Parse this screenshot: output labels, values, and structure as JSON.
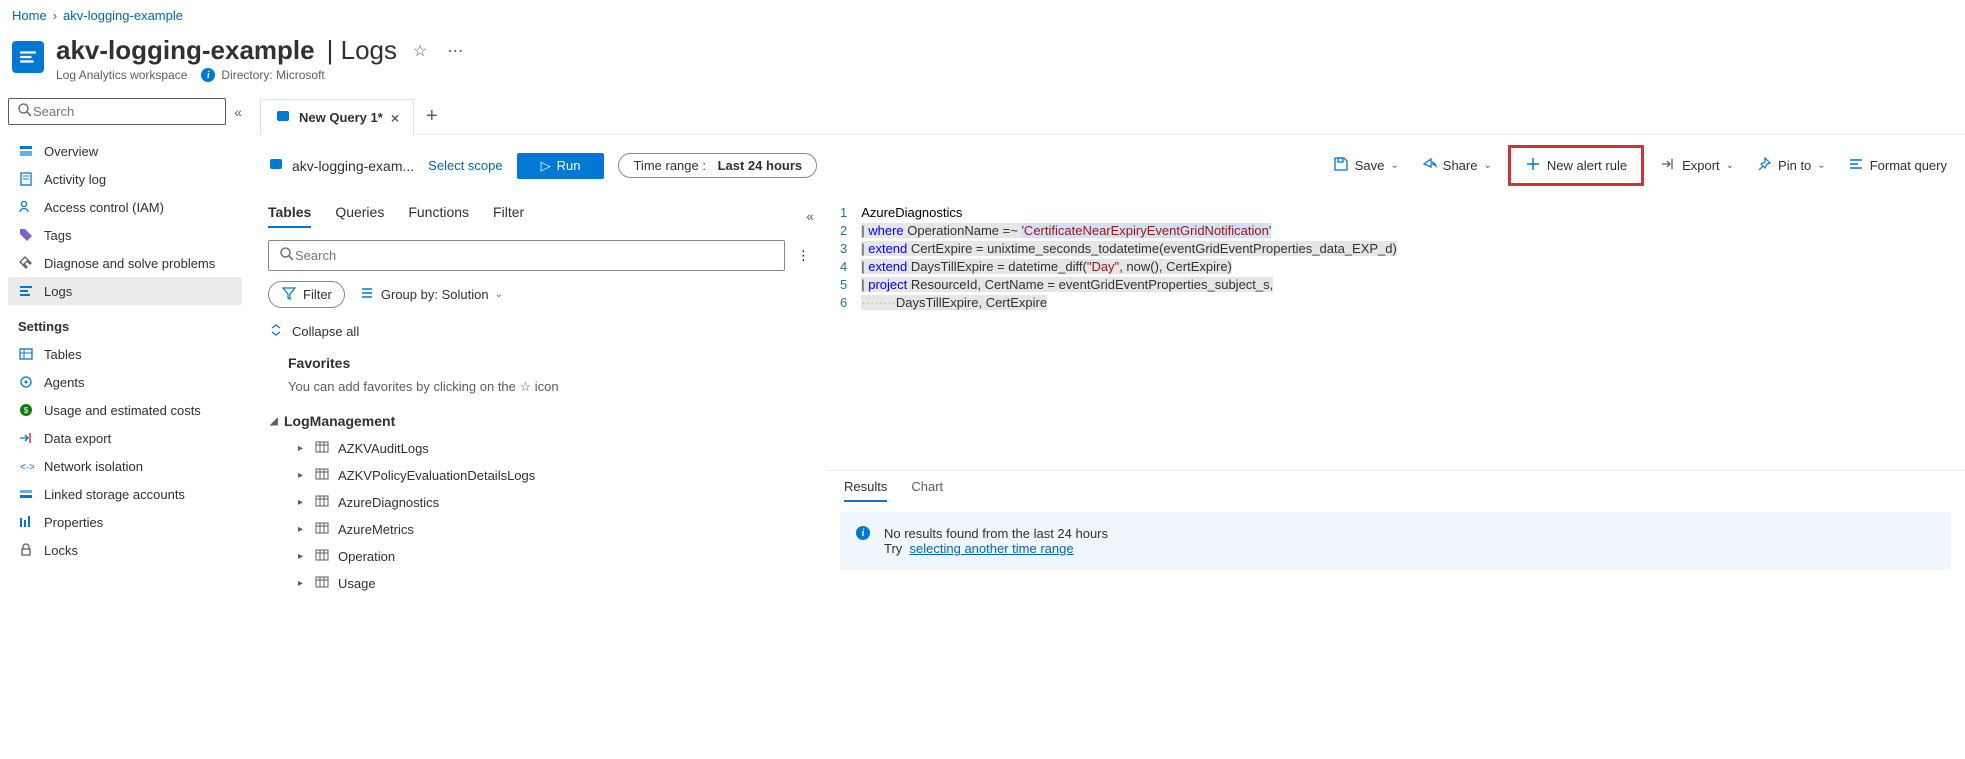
{
  "breadcrumb": {
    "home": "Home",
    "resource": "akv-logging-example"
  },
  "header": {
    "title": "akv-logging-example",
    "section": "Logs",
    "subtitle": "Log Analytics workspace",
    "directory_label": "Directory: Microsoft"
  },
  "sidebar": {
    "search_placeholder": "Search",
    "items_top": [
      {
        "label": "Overview",
        "icon": "overview"
      },
      {
        "label": "Activity log",
        "icon": "activity"
      },
      {
        "label": "Access control (IAM)",
        "icon": "access"
      },
      {
        "label": "Tags",
        "icon": "tags"
      },
      {
        "label": "Diagnose and solve problems",
        "icon": "diagnose"
      },
      {
        "label": "Logs",
        "icon": "logs",
        "active": true
      }
    ],
    "settings_label": "Settings",
    "items_settings": [
      {
        "label": "Tables",
        "icon": "tables"
      },
      {
        "label": "Agents",
        "icon": "agents"
      },
      {
        "label": "Usage and estimated costs",
        "icon": "usage"
      },
      {
        "label": "Data export",
        "icon": "export"
      },
      {
        "label": "Network isolation",
        "icon": "network"
      },
      {
        "label": "Linked storage accounts",
        "icon": "storage"
      },
      {
        "label": "Properties",
        "icon": "properties"
      },
      {
        "label": "Locks",
        "icon": "locks"
      }
    ]
  },
  "tabs": {
    "active": "New Query 1*"
  },
  "toolbar": {
    "scope": "akv-logging-exam...",
    "select_scope": "Select scope",
    "run": "Run",
    "time_label": "Time range :",
    "time_value": "Last 24 hours",
    "save": "Save",
    "share": "Share",
    "new_alert": "New alert rule",
    "export": "Export",
    "pin": "Pin to",
    "format": "Format query"
  },
  "left_panel": {
    "tab_tables": "Tables",
    "tab_queries": "Queries",
    "tab_functions": "Functions",
    "tab_filter": "Filter",
    "search_placeholder": "Search",
    "filter_btn": "Filter",
    "group_by": "Group by: Solution",
    "collapse_all": "Collapse all",
    "favorites": "Favorites",
    "favorites_hint": "You can add favorites by clicking on the ☆ icon",
    "group": "LogManagement",
    "tables": [
      "AZKVAuditLogs",
      "AZKVPolicyEvaluationDetailsLogs",
      "AzureDiagnostics",
      "AzureMetrics",
      "Operation",
      "Usage"
    ]
  },
  "editor": {
    "lines": [
      "AzureDiagnostics",
      "| where OperationName =~ 'CertificateNearExpiryEventGridNotification'",
      "| extend CertExpire = unixtime_seconds_todatetime(eventGridEventProperties_data_EXP_d)",
      "| extend DaysTillExpire = datetime_diff(\"Day\", now(), CertExpire)",
      "| project ResourceId, CertName = eventGridEventProperties_subject_s,",
      "········DaysTillExpire, CertExpire"
    ]
  },
  "results": {
    "tab_results": "Results",
    "tab_chart": "Chart",
    "no_results": "No results found from the last 24 hours",
    "try": "Try",
    "link": "selecting another time range"
  }
}
